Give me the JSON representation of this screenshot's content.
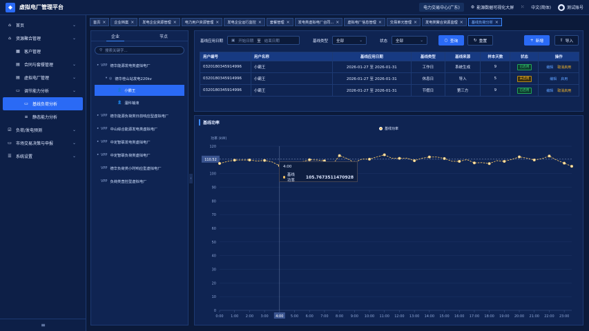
{
  "app": {
    "title": "虚拟电厂管理平台",
    "logo_glyph": "◆"
  },
  "topbar": {
    "org": "电力交易中心(广东)",
    "data_viz": "能源数据可视化大屏",
    "language": "中文(简体)",
    "user": "测试账号"
  },
  "sidebar": {
    "items": [
      {
        "label": "首页",
        "icon": "home-icon",
        "glyph": "⌂",
        "level": 0,
        "chevron": true
      },
      {
        "label": "资源聚合管理",
        "icon": "aggregate-icon",
        "glyph": "⌂",
        "level": 0,
        "chevron": true
      },
      {
        "label": "客户管理",
        "icon": "grid-icon",
        "glyph": "▦",
        "level": 1,
        "chevron": false
      },
      {
        "label": "合同与套餐管理",
        "icon": "doc-icon",
        "glyph": "▤",
        "level": 1,
        "chevron": true
      },
      {
        "label": "虚拟电厂管理",
        "icon": "doc-icon",
        "glyph": "▤",
        "level": 1,
        "chevron": true
      },
      {
        "label": "调节能力分析",
        "icon": "monitor-icon",
        "glyph": "▭",
        "level": 1,
        "chevron": true
      },
      {
        "label": "基线负荷分析",
        "icon": "monitor-icon",
        "glyph": "▭",
        "level": 2,
        "chevron": false,
        "active": true
      },
      {
        "label": "静态能力分析",
        "icon": "bars-icon",
        "glyph": "≡",
        "level": 2,
        "chevron": false
      },
      {
        "label": "负荷/发电预测",
        "icon": "check-icon",
        "glyph": "☑",
        "level": 0,
        "chevron": true
      },
      {
        "label": "市场交易决策与申报",
        "icon": "monitor-icon",
        "glyph": "▭",
        "level": 0,
        "chevron": true
      },
      {
        "label": "系统设置",
        "icon": "settings-icon",
        "glyph": "☰",
        "level": 0,
        "chevron": true
      }
    ],
    "collapse_glyph": "≡"
  },
  "tabs": [
    {
      "label": "首页",
      "active": false
    },
    {
      "label": "企业档案",
      "active": false
    },
    {
      "label": "发电企业资源管理",
      "active": false
    },
    {
      "label": "电力用户资源管理",
      "active": false
    },
    {
      "label": "发电企业运行监控",
      "active": false
    },
    {
      "label": "套餐管理",
      "active": false
    },
    {
      "label": "发电类虚拟电厂合同...",
      "active": false
    },
    {
      "label": "虚拟电厂信息管理",
      "active": false
    },
    {
      "label": "交易单元管理",
      "active": false
    },
    {
      "label": "发电类聚合资源监理",
      "active": false
    },
    {
      "label": "基线负荷分析",
      "active": true
    }
  ],
  "tree": {
    "tab_enterprise": "企业",
    "tab_node": "节点",
    "search_placeholder": "搜索关键字...",
    "nodes": [
      {
        "label": "德华能源发电类虚拟电厂",
        "level": 0,
        "caret": "▸",
        "tag": "VPP"
      },
      {
        "label": "德华桂山站发电220kv",
        "level": 1,
        "caret": "▾",
        "tag": "◎"
      },
      {
        "label": "小霸王",
        "level": 2,
        "caret": "",
        "tag": "👤",
        "selected": true
      },
      {
        "label": "温科输液",
        "level": 2,
        "caret": "",
        "tag": "👤"
      },
      {
        "label": "德华能源负荷类日前响应型虚拟电厂",
        "level": 0,
        "caret": "▸",
        "tag": "VPP"
      },
      {
        "label": "中山综合能源发电类虚拟电厂",
        "level": 0,
        "caret": "▸",
        "tag": "VPP"
      },
      {
        "label": "中定智联发电类虚拟电厂",
        "level": 0,
        "caret": "▸",
        "tag": "VPP"
      },
      {
        "label": "中定智联负荷类虚拟电厂",
        "level": 0,
        "caret": "▸",
        "tag": "VPP"
      },
      {
        "label": "德华负荷类小时响应型虚拟电厂",
        "level": 0,
        "caret": "",
        "tag": "VPP"
      },
      {
        "label": "负荷类直控型虚拟电厂",
        "level": 0,
        "caret": "",
        "tag": "VPP"
      }
    ]
  },
  "filters": {
    "date_label": "基线应用日期",
    "start_placeholder": "开始日期",
    "to": "至",
    "end_placeholder": "结束日期",
    "type_label": "基线类型",
    "type_value": "全部",
    "status_label": "状态",
    "status_value": "全部",
    "query": "查询",
    "reset": "重置",
    "add": "新增",
    "import": "导入"
  },
  "table": {
    "headers": [
      "用户编号",
      "用户名称",
      "基线应用日期",
      "基线类型",
      "基线来源",
      "样本天数",
      "状态",
      "操作"
    ],
    "rows": [
      {
        "id": "0320180345914996",
        "name": "小霸王",
        "dates": "2026-01-27 至 2026-01-31",
        "type": "工作日",
        "source": "系统生成",
        "days": "9",
        "status": "已启用",
        "status_kind": "ok",
        "ops": [
          "编辑",
          "取消启用"
        ]
      },
      {
        "id": "0320180345914996",
        "name": "小霸王",
        "dates": "2026-01-27 至 2026-01-31",
        "type": "休息日",
        "source": "导入",
        "days": "5",
        "status": "未启用",
        "status_kind": "warn",
        "ops": [
          "编辑",
          "启用"
        ]
      },
      {
        "id": "0320180345914996",
        "name": "小霸王",
        "dates": "2026-01-27 至 2026-01-31",
        "type": "节假日",
        "source": "第三方",
        "days": "9",
        "status": "已启用",
        "status_kind": "ok",
        "ops": [
          "编辑",
          "取消启用"
        ]
      }
    ]
  },
  "chart_panel": {
    "title": "基线功率"
  },
  "chart_data": {
    "type": "line",
    "title": "",
    "legend": "基线功率",
    "ylabel": "功率 (kW)",
    "ylim": [
      0,
      120
    ],
    "yticks": [
      0,
      10,
      20,
      30,
      40,
      50,
      60,
      70,
      80,
      90,
      100,
      110,
      120
    ],
    "categories": [
      "0:00",
      "1:00",
      "2:00",
      "3:00",
      "4:00",
      "5:00",
      "6:00",
      "7:00",
      "8:00",
      "9:00",
      "10:00",
      "11:00",
      "12:00",
      "13:00",
      "14:00",
      "15:00",
      "16:00",
      "17:00",
      "18:00",
      "19:00",
      "20:00",
      "21:00",
      "22:00",
      "23:00"
    ],
    "x": [
      "0:00",
      "0:30",
      "1:00",
      "1:30",
      "2:00",
      "2:30",
      "3:00",
      "3:30",
      "4:00",
      "4:30",
      "5:00",
      "5:30",
      "6:00",
      "6:30",
      "7:00",
      "7:30",
      "8:00",
      "8:30",
      "9:00",
      "9:30",
      "10:00",
      "10:30",
      "11:00",
      "11:30",
      "12:00",
      "12:30",
      "13:00",
      "13:30",
      "14:00",
      "14:30",
      "15:00",
      "15:30",
      "16:00",
      "16:30",
      "17:00",
      "17:30",
      "18:00",
      "18:30",
      "19:00",
      "19:30",
      "20:00",
      "20:30",
      "21:00",
      "21:30",
      "22:00",
      "22:30",
      "23:00",
      "23:30"
    ],
    "series": [
      {
        "name": "基线功率",
        "color": "#f2c264",
        "values": [
          107.4,
          108.8,
          109.8,
          109.9,
          109.9,
          109.1,
          109.6,
          108.5,
          105.8,
          108.7,
          107.6,
          108.6,
          110.1,
          109.9,
          109.3,
          106.0,
          113.1,
          111.0,
          108.1,
          110.6,
          110.5,
          112.2,
          113.7,
          111.2,
          111.1,
          111.3,
          109.4,
          111.2,
          112.1,
          112.1,
          111.0,
          109.0,
          108.9,
          110.2,
          107.8,
          108.0,
          107.3,
          109.4,
          108.9,
          110.3,
          112.2,
          111.3,
          109.9,
          110.8,
          112.8,
          109.8,
          107.6,
          105.3
        ]
      }
    ],
    "reference_line": 110.52,
    "reference_label": "110.52",
    "highlight_x": "4:00",
    "tooltip": {
      "time": "4:00",
      "name": "基线功率",
      "value": "105.7673511470928"
    }
  }
}
